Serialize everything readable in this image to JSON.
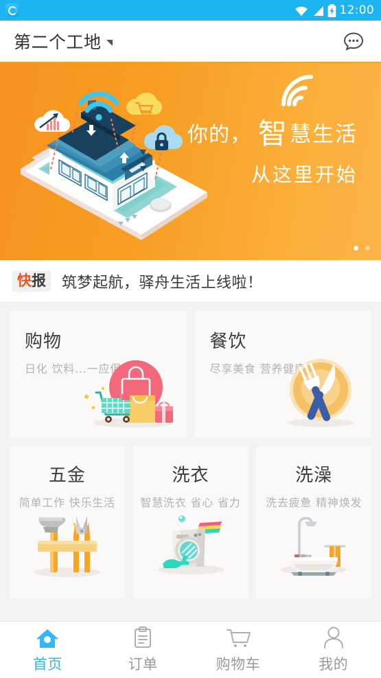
{
  "status_bar": {
    "time": "12:00",
    "icons": [
      "wifi-icon",
      "signal-icon",
      "battery-charging-icon"
    ],
    "bg_color": "#1CB5F1"
  },
  "header": {
    "title": "第二个工地",
    "dropdown_icon": "triangle-down-icon",
    "chat_icon": "chat-bubble-icon",
    "accent_color": "#F5A21E"
  },
  "banner": {
    "headline_prefix": "你的，",
    "headline_big": "智",
    "headline_rest": "慧生活",
    "subline": "从这里开始",
    "wifi_icon": "wifi-signal-icon",
    "illustration": "smart-home-on-phone-illustration",
    "bg_color": "#F89D23",
    "pagination": {
      "total": 2,
      "active_index": 0
    }
  },
  "news": {
    "badge_first": "快",
    "badge_second": "报",
    "text": "筑梦起航，驿舟生活上线啦！"
  },
  "cards": {
    "row1": [
      {
        "title": "购物",
        "subtitle": "日化 饮料...一应俱全",
        "art": "shopping-bag-cart-gift-illustration",
        "accent": "#F4687C"
      },
      {
        "title": "餐饮",
        "subtitle": "尽享美食 营养健康",
        "art": "plate-fork-knife-illustration",
        "accent": "#F5B042"
      }
    ],
    "row2": [
      {
        "title": "五金",
        "subtitle": "简单工作 快乐生活",
        "art": "hammer-pliers-illustration",
        "accent": "#F59A23"
      },
      {
        "title": "洗衣",
        "subtitle": "智慧洗衣 省心 省力",
        "art": "washing-machine-illustration",
        "accent": "#3FD8C8"
      },
      {
        "title": "洗澡",
        "subtitle": "洗去疲惫 精神焕发",
        "art": "bathtub-shower-illustration",
        "accent": "#F5A623"
      }
    ]
  },
  "tabbar": {
    "active_color": "#2FB9F5",
    "inactive_color": "#9A9A9A",
    "items": [
      {
        "label": "首页",
        "icon": "home-icon",
        "active": true
      },
      {
        "label": "订单",
        "icon": "clipboard-icon",
        "active": false
      },
      {
        "label": "购物车",
        "icon": "cart-icon",
        "active": false
      },
      {
        "label": "我的",
        "icon": "person-icon",
        "active": false
      }
    ]
  }
}
